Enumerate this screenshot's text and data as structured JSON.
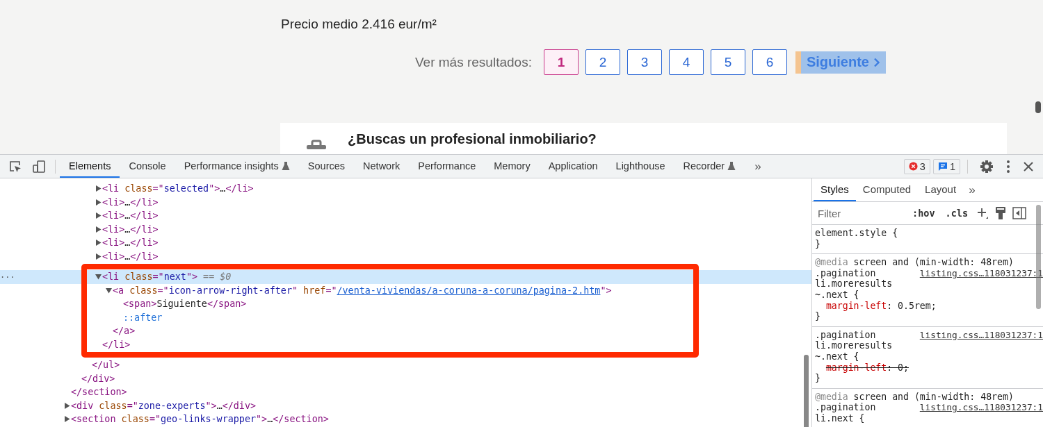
{
  "page": {
    "average_price": "Precio medio 2.416 eur/m²",
    "pagination": {
      "label": "Ver más resultados:",
      "pages": [
        {
          "label": "1",
          "selected": true
        },
        {
          "label": "2",
          "selected": false
        },
        {
          "label": "3",
          "selected": false
        },
        {
          "label": "4",
          "selected": false
        },
        {
          "label": "5",
          "selected": false
        },
        {
          "label": "6",
          "selected": false
        }
      ],
      "next": {
        "label": "Siguiente",
        "highlighted": true
      }
    },
    "card": {
      "heading": "¿Buscas un profesional inmobiliario?"
    }
  },
  "devtools": {
    "tabs": [
      {
        "label": "Elements",
        "selected": true,
        "experimental": false
      },
      {
        "label": "Console",
        "selected": false,
        "experimental": false
      },
      {
        "label": "Performance insights",
        "selected": false,
        "experimental": true
      },
      {
        "label": "Sources",
        "selected": false,
        "experimental": false
      },
      {
        "label": "Network",
        "selected": false,
        "experimental": false
      },
      {
        "label": "Performance",
        "selected": false,
        "experimental": false
      },
      {
        "label": "Memory",
        "selected": false,
        "experimental": false
      },
      {
        "label": "Application",
        "selected": false,
        "experimental": false
      },
      {
        "label": "Lighthouse",
        "selected": false,
        "experimental": false
      },
      {
        "label": "Recorder",
        "selected": false,
        "experimental": true
      }
    ],
    "more_tabs": "»",
    "errors": "3",
    "messages": "1",
    "tree": [
      {
        "close": [
          {
            "kind": "tag",
            "text": "</section>"
          }
        ],
        "children": [
          {
            "close": [
              {
                "kind": "tag",
                "text": "</div>"
              }
            ],
            "children": [
              {
                "close": [
                  {
                    "kind": "tag",
                    "text": "</ul>"
                  }
                ],
                "children": [
                  {
                    "parts": [
                      {
                        "kind": "tag",
                        "text": "<li"
                      },
                      {
                        "kind": "attr",
                        "text": " class"
                      },
                      {
                        "kind": "tag",
                        "text": "=\""
                      },
                      {
                        "kind": "value",
                        "text": "selected"
                      },
                      {
                        "kind": "tag",
                        "text": "\">"
                      },
                      {
                        "kind": "text",
                        "text": "…"
                      },
                      {
                        "kind": "tag",
                        "text": "</li>"
                      }
                    ],
                    "expanded": false,
                    "selected": false
                  },
                  {
                    "parts": [
                      {
                        "kind": "tag",
                        "text": "<li>"
                      },
                      {
                        "kind": "text",
                        "text": "…"
                      },
                      {
                        "kind": "tag",
                        "text": "</li>"
                      }
                    ],
                    "expanded": false,
                    "selected": false
                  },
                  {
                    "parts": [
                      {
                        "kind": "tag",
                        "text": "<li>"
                      },
                      {
                        "kind": "text",
                        "text": "…"
                      },
                      {
                        "kind": "tag",
                        "text": "</li>"
                      }
                    ],
                    "expanded": false,
                    "selected": false
                  },
                  {
                    "parts": [
                      {
                        "kind": "tag",
                        "text": "<li>"
                      },
                      {
                        "kind": "text",
                        "text": "…"
                      },
                      {
                        "kind": "tag",
                        "text": "</li>"
                      }
                    ],
                    "expanded": false,
                    "selected": false
                  },
                  {
                    "parts": [
                      {
                        "kind": "tag",
                        "text": "<li>"
                      },
                      {
                        "kind": "text",
                        "text": "…"
                      },
                      {
                        "kind": "tag",
                        "text": "</li>"
                      }
                    ],
                    "expanded": false,
                    "selected": false
                  },
                  {
                    "parts": [
                      {
                        "kind": "tag",
                        "text": "<li>"
                      },
                      {
                        "kind": "text",
                        "text": "…"
                      },
                      {
                        "kind": "tag",
                        "text": "</li>"
                      }
                    ],
                    "expanded": false,
                    "selected": false
                  },
                  {
                    "gutter": "···",
                    "parts": [
                      {
                        "kind": "tag",
                        "text": "<li"
                      },
                      {
                        "kind": "attr",
                        "text": " class"
                      },
                      {
                        "kind": "tag",
                        "text": "=\""
                      },
                      {
                        "kind": "value",
                        "text": "next"
                      },
                      {
                        "kind": "tag",
                        "text": "\">"
                      },
                      {
                        "kind": "note",
                        "text": " == *$0*"
                      }
                    ],
                    "expanded": true,
                    "selected": true,
                    "close": [
                      {
                        "kind": "tag",
                        "text": "</li>"
                      }
                    ],
                    "children": [
                      {
                        "parts": [
                          {
                            "kind": "tag",
                            "text": "<a"
                          },
                          {
                            "kind": "attr",
                            "text": " class"
                          },
                          {
                            "kind": "tag",
                            "text": "=\""
                          },
                          {
                            "kind": "value",
                            "text": "icon-arrow-right-after"
                          },
                          {
                            "kind": "tag",
                            "text": "\""
                          },
                          {
                            "kind": "attr",
                            "text": " href"
                          },
                          {
                            "kind": "tag",
                            "text": "=\""
                          },
                          {
                            "kind": "link",
                            "text": "/venta-viviendas/a-coruna-a-coruna/pagina-2.htm"
                          },
                          {
                            "kind": "tag",
                            "text": "\">"
                          }
                        ],
                        "expanded": true,
                        "selected": false,
                        "close": [
                          {
                            "kind": "tag",
                            "text": "</a>"
                          }
                        ],
                        "children": [
                          {
                            "parts": [
                              {
                                "kind": "tag",
                                "text": "<span>"
                              },
                              {
                                "kind": "text",
                                "text": "Siguiente"
                              },
                              {
                                "kind": "tag",
                                "text": "</span>"
                              }
                            ],
                            "selected": false
                          },
                          {
                            "parts": [
                              {
                                "kind": "pseudo",
                                "text": "::after"
                              }
                            ],
                            "selected": false
                          }
                        ]
                      }
                    ]
                  }
                ]
              }
            ]
          }
        ]
      },
      {
        "parts": [
          {
            "kind": "tag",
            "text": "<div"
          },
          {
            "kind": "attr",
            "text": " class"
          },
          {
            "kind": "tag",
            "text": "=\""
          },
          {
            "kind": "value",
            "text": "zone-experts"
          },
          {
            "kind": "tag",
            "text": "\">"
          },
          {
            "kind": "text",
            "text": "…"
          },
          {
            "kind": "tag",
            "text": "</div>"
          }
        ],
        "expanded": false,
        "selected": false
      },
      {
        "parts": [
          {
            "kind": "tag",
            "text": "<section"
          },
          {
            "kind": "attr",
            "text": " class"
          },
          {
            "kind": "tag",
            "text": "=\""
          },
          {
            "kind": "value",
            "text": "geo-links-wrapper"
          },
          {
            "kind": "tag",
            "text": "\">"
          },
          {
            "kind": "text",
            "text": "…"
          },
          {
            "kind": "tag",
            "text": "</section>"
          }
        ],
        "expanded": false,
        "selected": false
      }
    ],
    "sidebar": {
      "tabs": [
        {
          "label": "Styles",
          "selected": true
        },
        {
          "label": "Computed",
          "selected": false
        },
        {
          "label": "Layout",
          "selected": false
        }
      ],
      "more_tabs": "»",
      "filter": {
        "placeholder": "Filter"
      },
      "hov": ":hov",
      "cls": ".cls",
      "rules": [
        {
          "selector_lines": [
            "element.style {"
          ],
          "close": "}"
        },
        {
          "at_rule": "@media",
          "media_query": " screen and (min-width: 48rem)",
          "selector_lines": [
            ".pagination",
            "li.moreresults",
            "~.next {"
          ],
          "source": "listing.css…118031237:1",
          "declarations": [
            {
              "property": "margin-left",
              "value": ": 0.5rem;",
              "overridden": false
            }
          ],
          "close": "}"
        },
        {
          "selector_lines": [
            ".pagination",
            "li.moreresults",
            "~.next {"
          ],
          "source": "listing.css…118031237:1",
          "declarations": [
            {
              "property": "margin-left",
              "value": ": 0;",
              "overridden": true
            }
          ],
          "close": "}"
        },
        {
          "at_rule": "@media",
          "media_query": " screen and (min-width: 48rem)",
          "selector_lines": [
            ".pagination",
            "li.next {"
          ],
          "source": "listing.css…118031237:1"
        }
      ]
    }
  }
}
